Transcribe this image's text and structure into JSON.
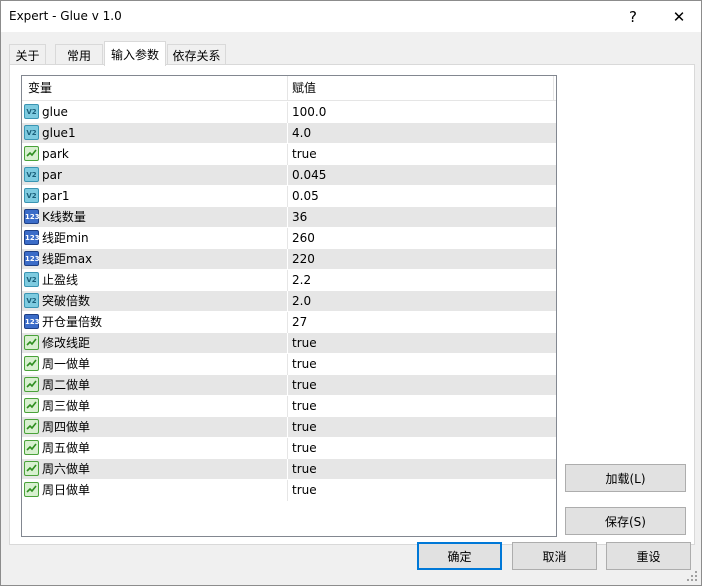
{
  "window": {
    "title": "Expert - Glue v 1.0",
    "help_label": "?",
    "close_label": "✕"
  },
  "tabs": [
    {
      "label": "关于",
      "active": false
    },
    {
      "label": "常用",
      "active": false
    },
    {
      "label": "输入参数",
      "active": true
    },
    {
      "label": "依存关系",
      "active": false
    }
  ],
  "grid": {
    "header": {
      "variable": "变量",
      "value": "赋值"
    },
    "rows": [
      {
        "type": "double",
        "name": "glue",
        "value": "100.0"
      },
      {
        "type": "double",
        "name": "glue1",
        "value": "4.0"
      },
      {
        "type": "bool",
        "name": "park",
        "value": "true"
      },
      {
        "type": "double",
        "name": "par",
        "value": "0.045"
      },
      {
        "type": "double",
        "name": "par1",
        "value": "0.05"
      },
      {
        "type": "int",
        "name": "K线数量",
        "value": "36"
      },
      {
        "type": "int",
        "name": "线距min",
        "value": "260"
      },
      {
        "type": "int",
        "name": "线距max",
        "value": "220"
      },
      {
        "type": "double",
        "name": "止盈线",
        "value": "2.2"
      },
      {
        "type": "double",
        "name": "突破倍数",
        "value": "2.0"
      },
      {
        "type": "int",
        "name": "开仓量倍数",
        "value": "27"
      },
      {
        "type": "bool",
        "name": "修改线距",
        "value": "true"
      },
      {
        "type": "bool",
        "name": "周一做单",
        "value": "true"
      },
      {
        "type": "bool",
        "name": "周二做单",
        "value": "true"
      },
      {
        "type": "bool",
        "name": "周三做单",
        "value": "true"
      },
      {
        "type": "bool",
        "name": "周四做单",
        "value": "true"
      },
      {
        "type": "bool",
        "name": "周五做单",
        "value": "true"
      },
      {
        "type": "bool",
        "name": "周六做单",
        "value": "true"
      },
      {
        "type": "bool",
        "name": "周日做单",
        "value": "true"
      }
    ],
    "icon_text": {
      "double": "V2",
      "int": "123"
    }
  },
  "side_buttons": {
    "load": "加载(L)",
    "save": "保存(S)"
  },
  "footer_buttons": {
    "ok": "确定",
    "cancel": "取消",
    "reset": "重设"
  }
}
